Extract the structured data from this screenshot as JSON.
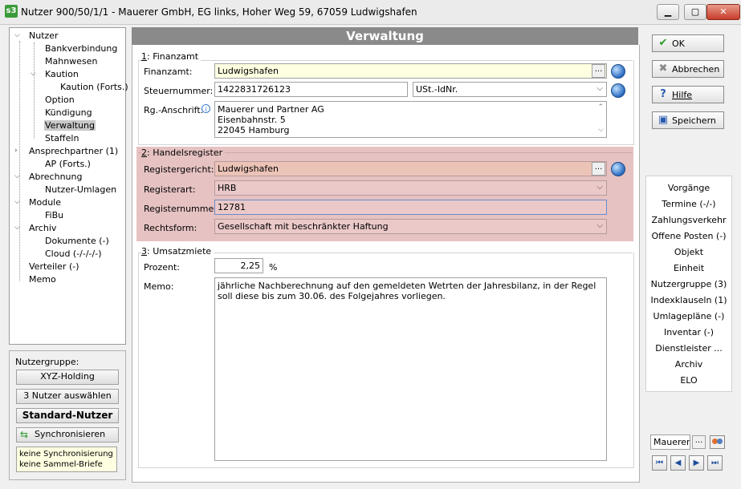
{
  "window": {
    "title": "Nutzer 900/50/1/1 - Mauerer GmbH, EG links, Hoher Weg 59, 67059 Ludwigshafen",
    "app_icon_text": "s3",
    "minimize": "▭",
    "maximize": "▢",
    "close": "✕"
  },
  "tree": {
    "items": [
      {
        "label": "Nutzer"
      },
      {
        "label": "Bankverbindung"
      },
      {
        "label": "Mahnwesen"
      },
      {
        "label": "Kaution"
      },
      {
        "label": "Kaution (Forts.)"
      },
      {
        "label": "Option"
      },
      {
        "label": "Kündigung"
      },
      {
        "label": "Verwaltung"
      },
      {
        "label": "Staffeln"
      },
      {
        "label": "Ansprechpartner (1)"
      },
      {
        "label": "AP (Forts.)"
      },
      {
        "label": "Abrechnung"
      },
      {
        "label": "Nutzer-Umlagen"
      },
      {
        "label": "Module"
      },
      {
        "label": "FiBu"
      },
      {
        "label": "Archiv"
      },
      {
        "label": "Dokumente (-)"
      },
      {
        "label": "Cloud (-/-/-/-)"
      },
      {
        "label": "Verteiler (-)"
      },
      {
        "label": "Memo"
      }
    ],
    "selected": "Verwaltung"
  },
  "group": {
    "label": "Nutzergruppe:",
    "group_button": "XYZ-Holding",
    "select_button": "3 Nutzer auswählen",
    "standard_button": "Standard-Nutzer",
    "sync_button": "Synchronisieren",
    "note_line1": "keine Synchronisierung",
    "note_line2": "keine Sammel-Briefe"
  },
  "main": {
    "header": "Verwaltung",
    "finanzamt": {
      "section_num": "1",
      "section_title": ": Finanzamt",
      "finanzamt_label": "Finanzamt:",
      "finanzamt_value": "Ludwigshafen",
      "steuer_label": "Steuernummer:",
      "steuer_value": "1422831726123",
      "steuer_type": "USt.-IdNr.",
      "anschrift_label": "Rg.-Anschrift:",
      "anschrift_lines": [
        "Mauerer und Partner AG",
        "Eisenbahnstr. 5",
        "22045 Hamburg"
      ]
    },
    "handelsregister": {
      "section_num": "2",
      "section_title": ": Handelsregister",
      "gericht_label": "Registergericht:",
      "gericht_value": "Ludwigshafen",
      "art_label": "Registerart:",
      "art_value": "HRB",
      "nummer_label": "Registernummer:",
      "nummer_value": "12781",
      "rechtsform_label": "Rechtsform:",
      "rechtsform_value": "Gesellschaft mit beschränkter Haftung"
    },
    "umsatzmiete": {
      "section_num": "3",
      "section_title": ": Umsatzmiete",
      "prozent_label": "Prozent:",
      "prozent_value": "2,25",
      "prozent_unit": "%",
      "memo_label": "Memo:",
      "memo_value": "jährliche Nachberechnung auf den gemeldeten Wetrten der Jahresbilanz, in der Regel soll diese bis zum 30.06. des Folgejahres vorliegen."
    }
  },
  "actions": {
    "ok": "OK",
    "cancel": "Abbrechen",
    "help": "Hilfe",
    "save": "Speichern"
  },
  "right_list": [
    "Vorgänge",
    "Termine (-/-)",
    "Zahlungsverkehr",
    "Offene Posten (-)",
    "Objekt",
    "Einheit",
    "Nutzergruppe (3)",
    "Indexklauseln (1)",
    "Umlagepläne (-)",
    "Inventar (-)",
    "Dienstleister ...",
    "Archiv",
    "ELO"
  ],
  "nav": {
    "search_value": "Mauerer",
    "dots": "..."
  }
}
